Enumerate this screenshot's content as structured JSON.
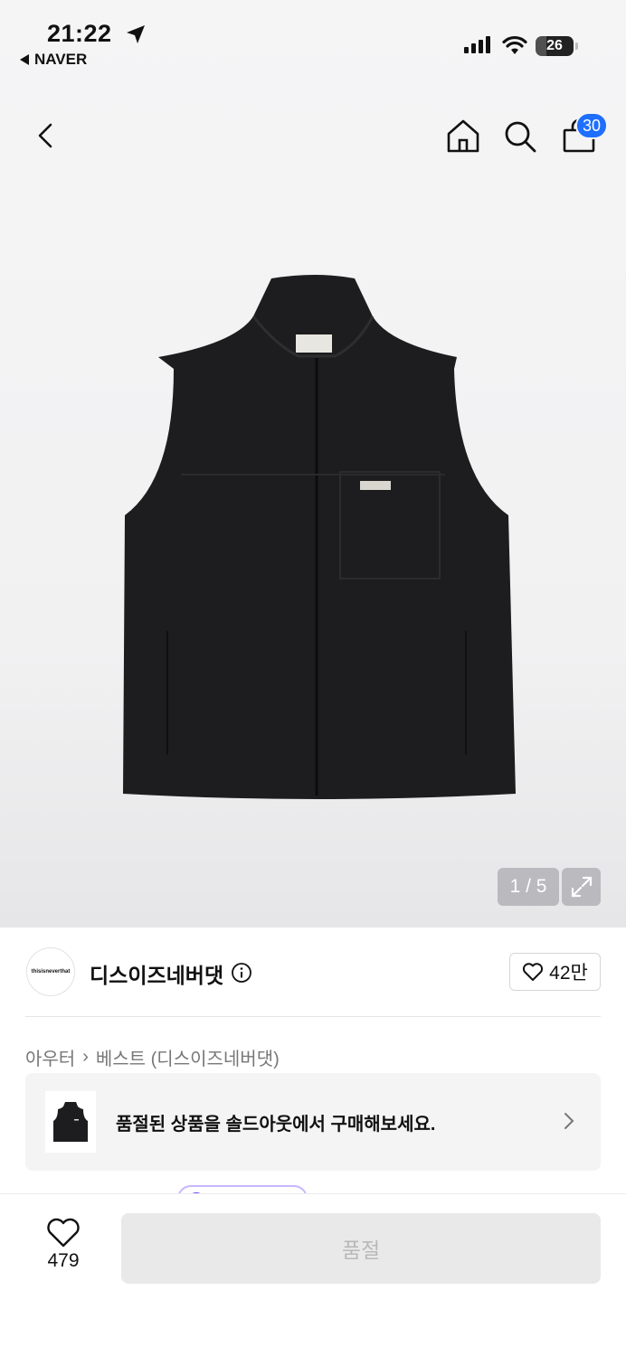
{
  "status_bar": {
    "time": "21:22",
    "back_app": "NAVER",
    "battery": "26"
  },
  "header": {
    "cart_count": "30"
  },
  "gallery": {
    "pager": "1 / 5",
    "label_text": "thisisneverthat"
  },
  "brand": {
    "logo_text": "thisisneverthat",
    "name": "디스이즈네버댓",
    "likes": "42만"
  },
  "breadcrumb": {
    "category": "아우터",
    "subcategory": "베스트 (디스이즈네버댓)"
  },
  "soldout_banner": {
    "text": "품절된 상품을 솔드아웃에서 구매해보세요."
  },
  "bottom_bar": {
    "wish_count": "479",
    "action_label": "품절"
  },
  "colors": {
    "accent": "#1e6fff",
    "garment": "#1d1d1f",
    "disabled_bg": "#e9e9ea"
  }
}
